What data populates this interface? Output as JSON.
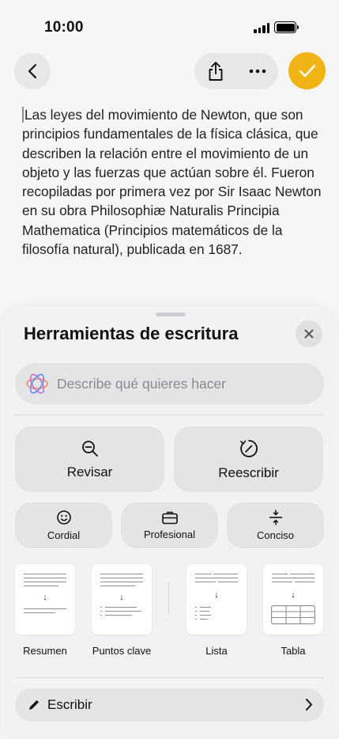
{
  "status_bar": {
    "time": "10:00"
  },
  "toolbar": {
    "back_icon": "chevron-left-icon",
    "share_icon": "share-icon",
    "more_icon": "ellipsis-icon",
    "done_icon": "checkmark-icon",
    "accent_color": "#f0b514"
  },
  "document": {
    "text": "Las leyes del movimiento de Newton, que son principios fundamentales de la física clásica, que describen la relación entre el movimiento de un objeto y las fuerzas que actúan sobre él. Fueron recopiladas por primera vez por Sir Isaac Newton en su obra Philosophiæ Naturalis Principia Mathematica (Principios matemáticos de la filosofía natural), publicada en 1687."
  },
  "sheet": {
    "title": "Herramientas de escritura",
    "close_icon": "close-icon",
    "prompt_placeholder": "Describe qué quieres hacer",
    "actions": [
      {
        "label": "Revisar",
        "icon": "magnifier-minus-icon"
      },
      {
        "label": "Reescribir",
        "icon": "rewrite-circle-icon"
      }
    ],
    "tones": [
      {
        "label": "Cordial",
        "icon": "smiley-icon"
      },
      {
        "label": "Profesional",
        "icon": "briefcase-icon"
      },
      {
        "label": "Conciso",
        "icon": "compress-icon"
      }
    ],
    "formats": [
      {
        "label": "Resumen"
      },
      {
        "label": "Puntos clave"
      },
      {
        "label": "Lista"
      },
      {
        "label": "Tabla"
      }
    ],
    "write": {
      "label": "Escribir",
      "icon": "pencil-icon"
    }
  }
}
